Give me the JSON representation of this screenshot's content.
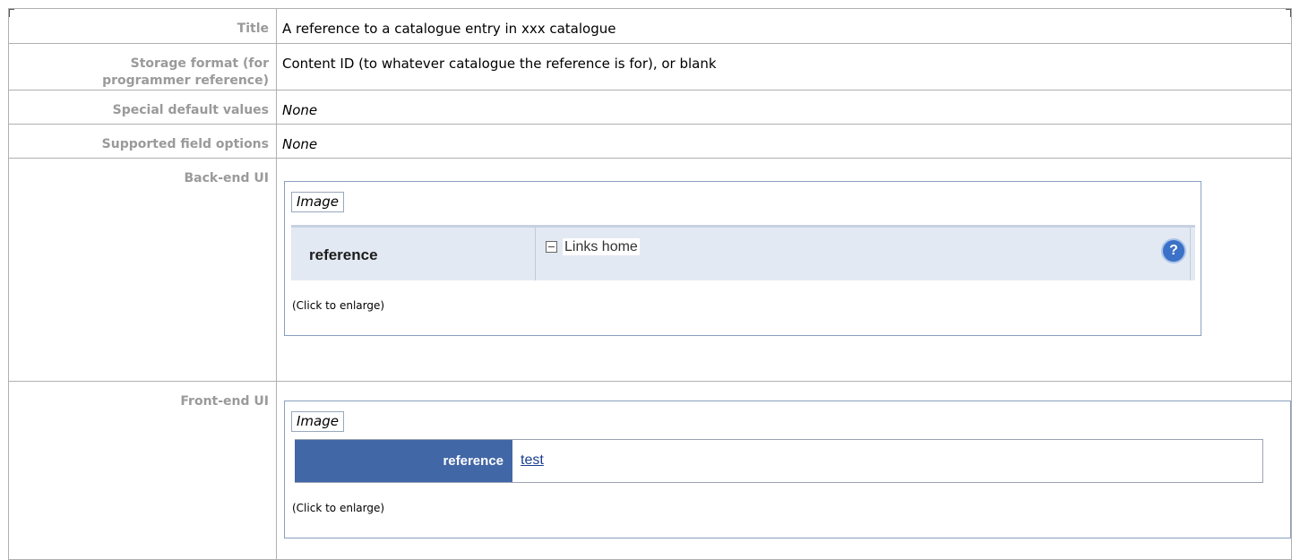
{
  "rows": {
    "title": {
      "label": "Title",
      "value": "A reference to a catalogue entry in xxx catalogue"
    },
    "storage": {
      "label_line1": "Storage format (for",
      "label_line2": "programmer reference)",
      "value": "Content ID (to whatever catalogue the reference is for), or blank"
    },
    "defaults": {
      "label": "Special default values",
      "value": "None"
    },
    "options": {
      "label": "Supported field options",
      "value": "None"
    },
    "backend": {
      "label": "Back-end UI",
      "image_tag": "Image",
      "screenshot": {
        "field_label": "reference",
        "field_value": "Links home",
        "help_icon": "help-icon"
      },
      "caption": "(Click to enlarge)"
    },
    "frontend": {
      "label": "Front-end UI",
      "image_tag": "Image",
      "screenshot": {
        "field_label": "reference",
        "field_value": "test"
      },
      "caption": "(Click to enlarge)"
    }
  },
  "colors": {
    "label_text": "#9a9a9a",
    "backend_bg": "#e3e9f2",
    "frontend_label_bg": "#4267a7",
    "help_icon": "#3b71c6"
  }
}
